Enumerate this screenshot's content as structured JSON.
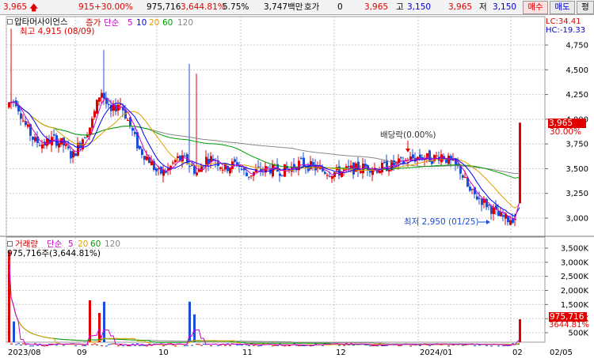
{
  "topbar": {
    "price": "3,965",
    "up_arrow": "🡅",
    "change": "915",
    "change_pct": "+30.00%",
    "volume": "975,716",
    "volume_pct": "3,644.81%",
    "turnover_pct": "5.75%",
    "amount": "3,747백만",
    "quote_label": "호가",
    "quote_value": "0",
    "quote_price": "3,965",
    "high_label": "고",
    "high_value": "3,150",
    "low_price": "3,965",
    "low_label": "저",
    "low_value": "3,150",
    "buy_label": "매수",
    "sell_label": "매도",
    "eval_label": "평"
  },
  "price_panel": {
    "stock_name": "압타머사이언스",
    "indicator_label": "증가",
    "ma_label": "단순",
    "ma_periods": [
      "5",
      "10",
      "20",
      "60",
      "120"
    ],
    "high_label": "최고 4,915 (08/09)",
    "lc_label": "LC:34.41",
    "hc_label": "HC:-19.33",
    "dividend_label": "배당락(0.00%)",
    "low_annot": "최저 2,950 (01/25)",
    "current_price_tag": "3,965",
    "current_pct_tag": "30.00%"
  },
  "volume_panel": {
    "title": "거래량",
    "ma_label": "단순",
    "ma_periods": [
      "5",
      "20",
      "60",
      "120"
    ],
    "value_label": "975,716주(3,644.81%)",
    "current_volume_tag": "975,716",
    "current_pct_tag": "3644.81%"
  },
  "colors": {
    "up": "#e00000",
    "down": "#1c4fd6",
    "ma5": "#cc00cc",
    "ma10": "#0000ff",
    "ma20": "#e0a000",
    "ma60": "#00a000",
    "ma120": "#888888"
  },
  "chart_data": [
    {
      "type": "candlestick",
      "title": "압타머사이언스",
      "y_ticks": [
        "4,750",
        "4,500",
        "4,250",
        "4,000",
        "3,750",
        "3,500",
        "3,250",
        "3,000"
      ],
      "ylim": [
        2900,
        4950
      ],
      "last": 3965,
      "high": {
        "value": 4915,
        "date": "08/09"
      },
      "low": {
        "value": 2950,
        "date": "01/25"
      },
      "x_ticks": [
        "2023/08",
        "09",
        "10",
        "11",
        "12",
        "2024/01",
        "02",
        "02/05"
      ]
    },
    {
      "type": "bar",
      "title": "거래량",
      "y_ticks": [
        "3,500K",
        "3,000K",
        "2,500K",
        "2,000K",
        "1,500K",
        "1,000K",
        "500K"
      ],
      "ylim": [
        0,
        3750000
      ],
      "last": 975716
    }
  ]
}
